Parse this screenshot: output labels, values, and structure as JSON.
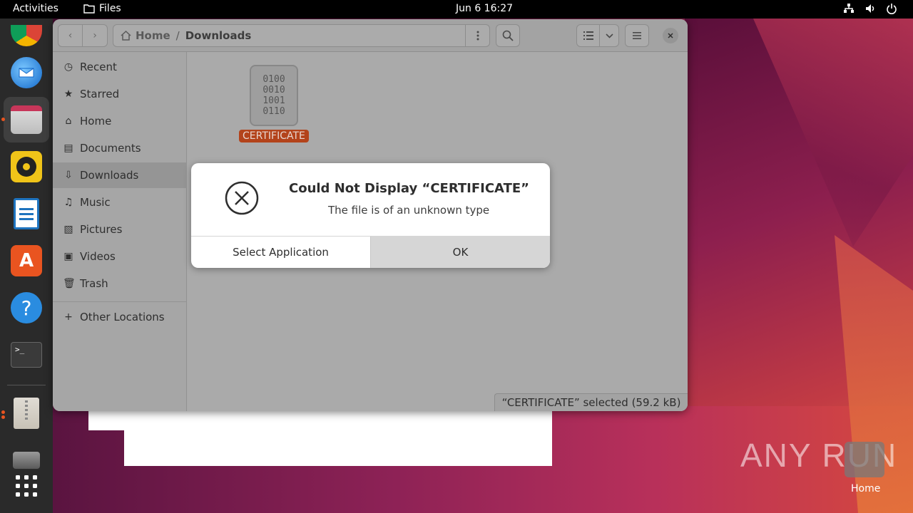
{
  "topbar": {
    "activities": "Activities",
    "app_name": "Files",
    "clock": "Jun 6  16:27"
  },
  "files": {
    "path": {
      "home": "Home",
      "separator": "/",
      "current": "Downloads"
    },
    "sidebar": [
      {
        "label": "Recent",
        "icon": "clock-icon"
      },
      {
        "label": "Starred",
        "icon": "star-icon"
      },
      {
        "label": "Home",
        "icon": "home-icon"
      },
      {
        "label": "Documents",
        "icon": "document-icon"
      },
      {
        "label": "Downloads",
        "icon": "download-icon"
      },
      {
        "label": "Music",
        "icon": "music-icon"
      },
      {
        "label": "Pictures",
        "icon": "picture-icon"
      },
      {
        "label": "Videos",
        "icon": "video-icon"
      },
      {
        "label": "Trash",
        "icon": "trash-icon"
      },
      {
        "label": "Other Locations",
        "icon": "plus-icon"
      }
    ],
    "file": {
      "name": "CERTIFICATE",
      "glyph_lines": [
        "0100",
        "0010",
        "1001",
        "0110"
      ]
    },
    "status": "“CERTIFICATE” selected  (59.2 kB)"
  },
  "dialog": {
    "title": "Could Not Display “CERTIFICATE”",
    "message": "The file is of an unknown type",
    "select_button": "Select Application",
    "ok_button": "OK"
  },
  "desktop": {
    "watermark": "ANY RUN",
    "home_label": "Home"
  },
  "colors": {
    "selection_accent": "#b3431b",
    "dock_indicator": "#e95420"
  }
}
